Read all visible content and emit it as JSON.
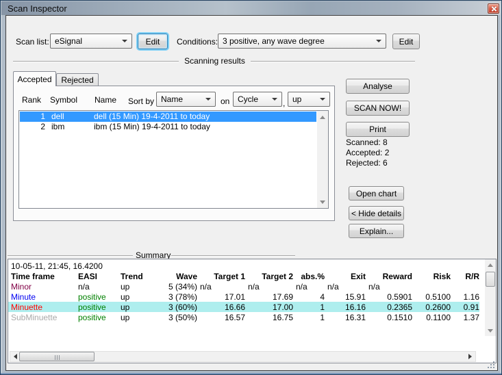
{
  "window": {
    "title": "Scan Inspector"
  },
  "toolbar": {
    "scan_list_label": "Scan list:",
    "scan_list_value": "eSignal",
    "edit_scan_label": "Edit",
    "conditions_label": "Conditions:",
    "conditions_value": "3 positive, any wave degree",
    "edit_conditions_label": "Edit"
  },
  "results": {
    "group_label": "Scanning results",
    "tabs": [
      "Accepted",
      "Rejected"
    ],
    "columns": {
      "rank": "Rank",
      "symbol": "Symbol",
      "name": "Name"
    },
    "sort": {
      "sort_by_label": "Sort by",
      "sort_by_value": "Name",
      "on_label": "on",
      "on_value": "Cycle",
      "separator": ",",
      "direction_value": "up"
    },
    "rows": [
      {
        "rank": "1",
        "symbol": "dell",
        "name": "dell (15 Min)  19-4-2011 to today"
      },
      {
        "rank": "2",
        "symbol": "ibm",
        "name": "ibm (15 Min)  19-4-2011 to today"
      }
    ],
    "buttons": {
      "analyse": "Analyse",
      "scan_now": "SCAN NOW!",
      "print": "Print",
      "open_chart": "Open chart",
      "hide_details": "< Hide details",
      "explain": "Explain..."
    },
    "stats": {
      "scanned": "Scanned: 8",
      "accepted": "Accepted: 2",
      "rejected": "Rejected: 6"
    }
  },
  "summary": {
    "group_label": "Summary",
    "timestamp": "10-05-11, 21:45, 16.4200",
    "headers": [
      "Time frame",
      "EASI",
      "Trend",
      "Wave",
      "Target 1",
      "Target 2",
      "abs.%",
      "Exit",
      "Reward",
      "Risk",
      "R/R"
    ],
    "rows": [
      [
        "Minor",
        "n/a",
        "up",
        "5 (34%)",
        "n/a",
        "n/a",
        "n/a",
        "n/a",
        "n/a",
        "",
        ""
      ],
      [
        "Minute",
        "positive",
        "up",
        "3 (78%)",
        "17.01",
        "17.69",
        "4",
        "15.91",
        "0.5901",
        "0.5100",
        "1.16"
      ],
      [
        "Minuette",
        "positive",
        "up",
        "3 (60%)",
        "16.66",
        "17.00",
        "1",
        "16.16",
        "0.2365",
        "0.2600",
        "0.91"
      ],
      [
        "SubMinuette",
        "positive",
        "up",
        "3 (50%)",
        "16.57",
        "16.75",
        "1",
        "16.31",
        "0.1510",
        "0.1100",
        "1.37"
      ]
    ]
  },
  "colors": {
    "selection_blue": "#3399ff",
    "highlight_cyan": "#aeeeee",
    "minor": "#800045",
    "minute": "#0000f0",
    "minuette": "#ff0000",
    "subminuette": "#a9a9a9",
    "positive_green": "#008000",
    "close_button_red": "#c33d27",
    "titlebar_gray_blue": "#9fadbb"
  }
}
